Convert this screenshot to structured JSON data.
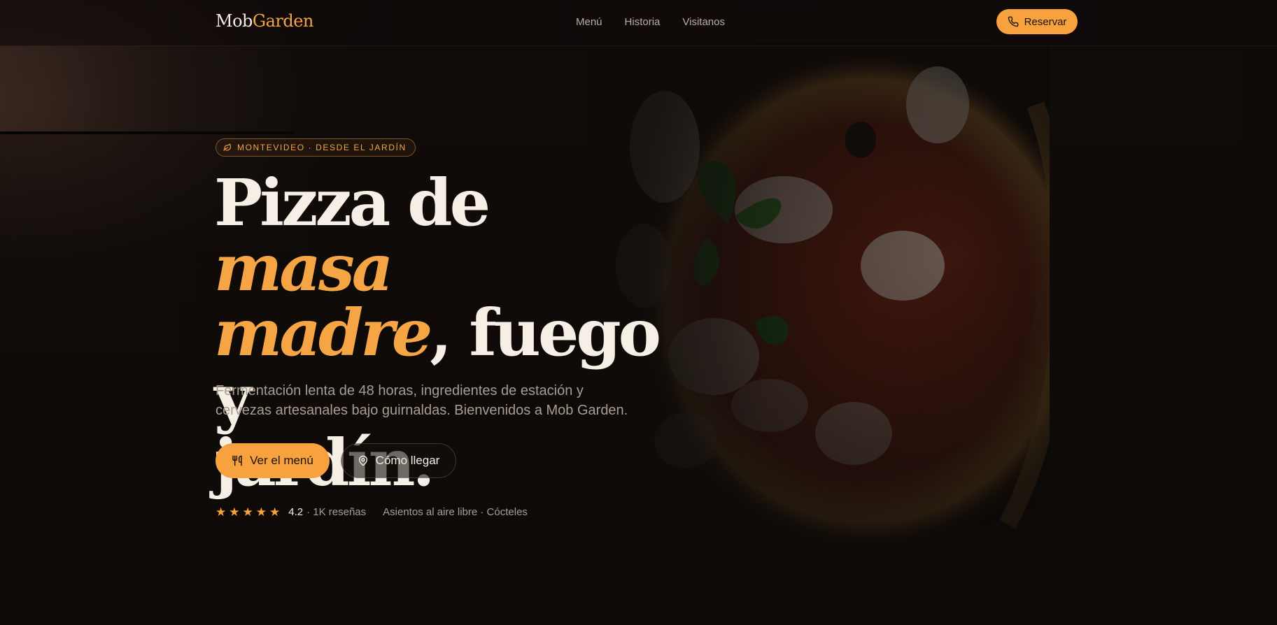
{
  "brand": {
    "part1": "Mob",
    "part2": "Garden"
  },
  "nav": {
    "items": [
      "Menú",
      "Historia",
      "Visitanos"
    ]
  },
  "header": {
    "reserve_label": "Reservar"
  },
  "hero": {
    "badge": "MONTEVIDEO · DESDE EL JARDÍN",
    "headline": {
      "part1": "Pizza de ",
      "accent1": "masa",
      "accent2": "madre",
      "part2": ", fuego y",
      "part3": "jardín."
    },
    "description": "Fermentación lenta de 48 horas, ingredientes de estación y cervezas artesanales bajo guirnaldas. Bienvenidos a Mob Garden.",
    "primary_button": "Ver el menú",
    "secondary_button": "Cómo llegar"
  },
  "rating": {
    "stars": 5,
    "score": "4.2",
    "reviews": "· 1K reseñas",
    "extra": "Asientos al aire libre · Cócteles"
  },
  "colors": {
    "accent": "#f7a13f",
    "background": "#0f0b09",
    "text": "#f6efe6",
    "muted": "#a99d92"
  },
  "icons": {
    "badge": "leaf-icon",
    "reserve": "phone-icon",
    "menu": "utensils-icon",
    "directions": "map-pin-icon",
    "rating": "star-icon"
  }
}
